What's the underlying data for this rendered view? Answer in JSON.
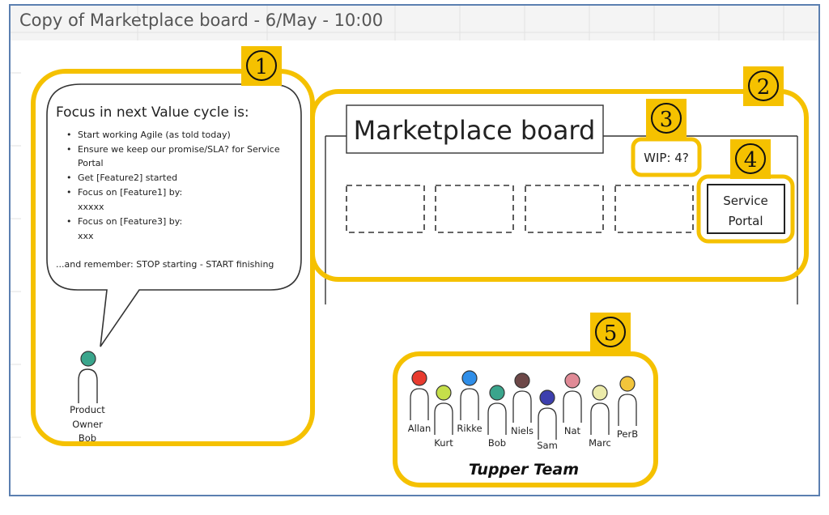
{
  "title": "Copy of Marketplace board - 6/May - 10:00",
  "bubble": {
    "heading": "Focus in next Value cycle is:",
    "bullets": [
      "Start working Agile (as told today)",
      "Ensure we keep our promise/SLA? for Service",
      "Portal",
      "Get [Feature2] started",
      "Focus on [Feature1] by:",
      "xxxxx",
      "Focus on [Feature3] by:",
      "xxx"
    ],
    "closing": "...and remember: STOP starting - START finishing"
  },
  "product_owner": {
    "line1": "Product",
    "line2": "Owner",
    "line3": "Bob",
    "color": "#3aa58c"
  },
  "board": {
    "title": "Marketplace board",
    "wip": "WIP: 4?",
    "service_line1": "Service",
    "service_line2": "Portal"
  },
  "callouts": [
    "1",
    "2",
    "3",
    "4",
    "5"
  ],
  "team": {
    "name": "Tupper Team",
    "members": [
      {
        "name": "Allan",
        "color": "#e83b2f"
      },
      {
        "name": "Kurt",
        "color": "#c5df4a"
      },
      {
        "name": "Rikke",
        "color": "#2f8ee8"
      },
      {
        "name": "Bob",
        "color": "#3aa58c"
      },
      {
        "name": "Niels",
        "color": "#6d4848"
      },
      {
        "name": "Sam",
        "color": "#3d3fae"
      },
      {
        "name": "Nat",
        "color": "#e08a96"
      },
      {
        "name": "Marc",
        "color": "#ecebaa"
      },
      {
        "name": "PerB",
        "color": "#f2c53b"
      }
    ]
  },
  "colors": {
    "highlight": "#f5c100",
    "frame": "#5b7fb0"
  }
}
